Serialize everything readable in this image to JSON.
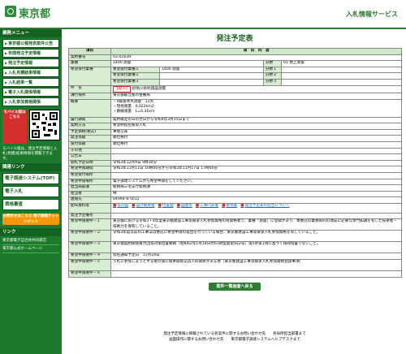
{
  "header": {
    "logo_text": "東京都",
    "site_name": "入札情報サービス"
  },
  "sidebar": {
    "section1_title": "業務メニュー",
    "items": [
      "東京都公報発表案件公告",
      "年間発注予定情報",
      "発注予定情報",
      "入札見積結果情報",
      "入札結果一覧",
      "電子入札関係情報",
      "入札参加資格関係"
    ],
    "mobile_label": "モバイル版はこちら",
    "mobile_note": "モバイル版は、発注予定情報と入札(見積)結果情報を閲覧できます。",
    "section2_title": "関連リンク",
    "big_items": [
      "電子調達システム(TOP)",
      "電子入札",
      "資格審査"
    ],
    "orange_btn": "お問合せはこちら 電子調達チャットボット",
    "section3_title": "リンク",
    "links": [
      "東京都電子自治体共同運営",
      "東京都公式ホームページ"
    ]
  },
  "main": {
    "page_title": "発注予定表",
    "col_item": "項目",
    "col_content": "項　目　内　容",
    "rows": {
      "contract_no": {
        "label": "契約番号",
        "value": "03-01639"
      },
      "industry": {
        "label": "業種",
        "value": "1400 測量",
        "bunya": "分野",
        "bunya_value": "01 地上測量"
      },
      "desired": {
        "label": "希望受付業種",
        "items": [
          {
            "name": "希望受付業種１",
            "value": "1400 測量",
            "bunya": "分野１"
          },
          {
            "name": "希望受付業種２",
            "value": "",
            "bunya": "分野２"
          },
          {
            "name": "希望受付業種３",
            "value": "",
            "bunya": "分野３"
          }
        ]
      },
      "name": {
        "label": "件　名",
        "tag": "【電子】",
        "value": "砂防川砂防施設測量"
      },
      "department": {
        "label": "課行場所",
        "value": "東京都都立都市整備局"
      },
      "overview": {
        "label": "概要",
        "lines": [
          "・4級基準点測量　12点",
          "・現地測量　0.022km2",
          "・路線測量　L=0.31km"
        ]
      },
      "period": {
        "label": "履行期間",
        "value": "契約確定の日の翌日から令和4年3月15日まで"
      },
      "method": {
        "label": "契約方法",
        "value": "希望制指名競争入札"
      },
      "budget": {
        "label": "予定価格(税込)",
        "value": "事後公表"
      },
      "ordering_body": {
        "label": "発注等級",
        "value": "順位格付"
      },
      "grade": {
        "label": "受付等級",
        "value": "順位格付"
      },
      "other": {
        "label": "その他",
        "value": ""
      },
      "announce_date": {
        "label": "公告日",
        "value": ""
      },
      "open_date": {
        "label": "開札予定日時",
        "value": "令和3年12月9日 9時30分"
      },
      "accept_period": {
        "label": "希望申請期間",
        "value": "令和3年11月11日 10時00分から令和3年11月17日 17時00分"
      },
      "accept_method": {
        "label": "希望受付場所",
        "value": ""
      },
      "submission": {
        "label": "希望申請場所",
        "value": "電子調達システムから希望申請をしてください。"
      },
      "contact_dept": {
        "label": "担当局部課",
        "value": "総務局三宅支庁総務課"
      },
      "contact_person": {
        "label": "担当者",
        "value": "林"
      },
      "phone": {
        "label": "連絡先",
        "value": "04994-8-5012"
      },
      "files": {
        "label": "配布資料等",
        "items": [
          "案内図",
          "設計概要書",
          "位置図",
          "図面等",
          "工事内訳書",
          "要領書",
          "発注予定表の提出について"
        ]
      },
      "related": {
        "label": "発注予定備考",
        "value": ""
      },
      "remarks": [
        {
          "label": "希望申請要件－１",
          "value": "東京都における令和3・4年度東京都建設工事等競争入札参加資格の有資格者で、業種「測量」に登録があり、本委託の業務目的の達成に必要な専門知識を有した技術者・技術力を保有していること。"
        },
        {
          "label": "希望申請要件－２",
          "value": "令和3年度以前の工事又は委託に希望申請の提出を行っている場合、東京都建設工事等競争入札参加資格を有していること。"
        },
        {
          "label": "希望申請要件－３",
          "value": "東京都契約関係暴力団等対策措置要綱（昭和62年1月14日付61財契発第922号）第5条第1項に基づく排除措置でないこと。"
        },
        {
          "label": "希望申請要件－４",
          "value": "指名通知予定日　11月24日"
        },
        {
          "label": "希望申請要件－５",
          "value": "入札に参加しようとする者の間に資本関係又は人的関係がある者（東京都建設工事等競争入札参加資格登録事項）"
        },
        {
          "label": "希望申請要件－６",
          "value": ""
        }
      ]
    },
    "back_button": "案件一覧画面へ戻る"
  },
  "footer": {
    "line1": "発注予定情報に掲載されている各案件に関するお問い合わせ先　　各局所担当部署まで",
    "line2": "画面操作に関するお問い合わせ先　　東京都電子調達システムヘルプデスクまで"
  }
}
